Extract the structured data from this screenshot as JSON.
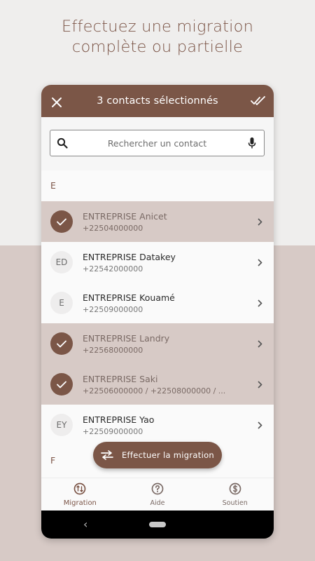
{
  "headline": {
    "line1": "Effectuez une migration",
    "line2": "complète ou partielle"
  },
  "appbar": {
    "title": "3 contacts sélectionnés",
    "close_icon": "close-icon",
    "select_all_icon": "double-check-icon"
  },
  "search": {
    "placeholder": "Rechercher un contact",
    "search_icon": "search-icon",
    "mic_icon": "microphone-icon"
  },
  "sections": [
    {
      "letter": "E"
    },
    {
      "letter": "F"
    }
  ],
  "contacts": [
    {
      "name": "ENTREPRISE Anicet",
      "phone": "+22504000000",
      "initials": "",
      "selected": true
    },
    {
      "name": "ENTREPRISE Datakey",
      "phone": "+22542000000",
      "initials": "ED",
      "selected": false
    },
    {
      "name": "ENTREPRISE Kouamé",
      "phone": "+22509000000",
      "initials": "E",
      "selected": false
    },
    {
      "name": "ENTREPRISE Landry",
      "phone": "+22568000000",
      "initials": "",
      "selected": true
    },
    {
      "name": "ENTREPRISE Saki",
      "phone": "+22506000000 / +22508000000 / ...",
      "initials": "",
      "selected": true
    },
    {
      "name": "ENTREPRISE Yao",
      "phone": "+22509000000",
      "initials": "EY",
      "selected": false
    }
  ],
  "fab": {
    "label": "Effectuer la migration",
    "icon": "swap-arrows-icon"
  },
  "bottom_nav": [
    {
      "label": "Migration",
      "icon": "migration-icon",
      "active": true
    },
    {
      "label": "Aide",
      "icon": "help-icon",
      "active": false
    },
    {
      "label": "Soutien",
      "icon": "dollar-icon",
      "active": false
    }
  ],
  "colors": {
    "brand": "#7b5647",
    "selected_row": "#d7cac6",
    "headline": "#7b5446"
  }
}
